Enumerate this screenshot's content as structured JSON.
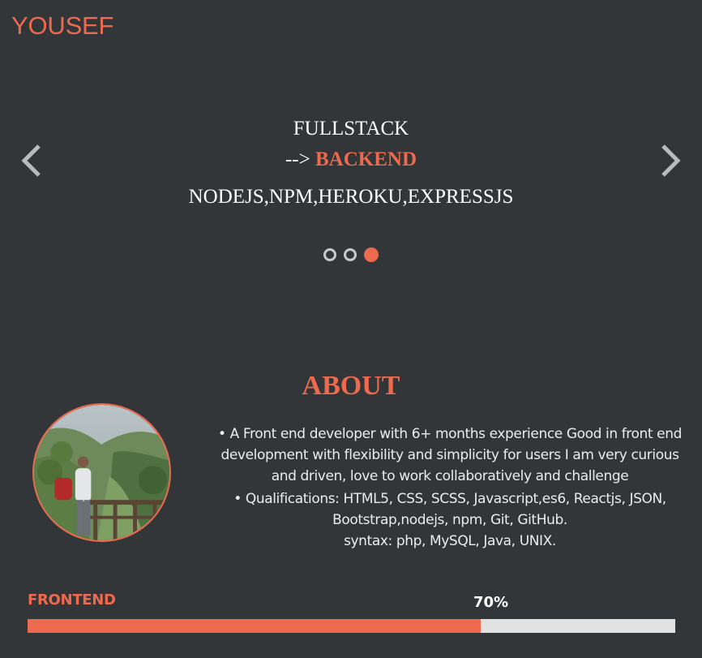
{
  "header": {
    "brand": "YOUSEF"
  },
  "slider": {
    "line1": "FULLSTACK",
    "line2_prefix": "-->",
    "line2_highlight": "BACKEND",
    "line3": "NODEJS,NPM,HEROKU,EXPRESSJS",
    "prev_icon": "chevron-left-icon",
    "next_icon": "chevron-right-icon",
    "dots": [
      {
        "active": false
      },
      {
        "active": false
      },
      {
        "active": true
      }
    ]
  },
  "about": {
    "title": "ABOUT",
    "paragraph1": "• A Front end developer with 6+ months experience Good in front end development with flexibility and simplicity for users I am very curious and driven, love to work collaboratively and challenge",
    "paragraph2": "• Qualifications: HTML5, CSS, SCSS, Javascript,es6, Reactjs, JSON, Bootstrap,nodejs, npm, Git, GitHub.",
    "paragraph3": "syntax: php, MySQL, Java, UNIX."
  },
  "skills": [
    {
      "name": "FRONTEND",
      "percent_label": "70%",
      "level": 0.7
    }
  ],
  "colors": {
    "background": "#333638",
    "accent": "#ee6a4e",
    "track": "#e1e1e1",
    "dot_inactive": "#c9c9c9"
  }
}
